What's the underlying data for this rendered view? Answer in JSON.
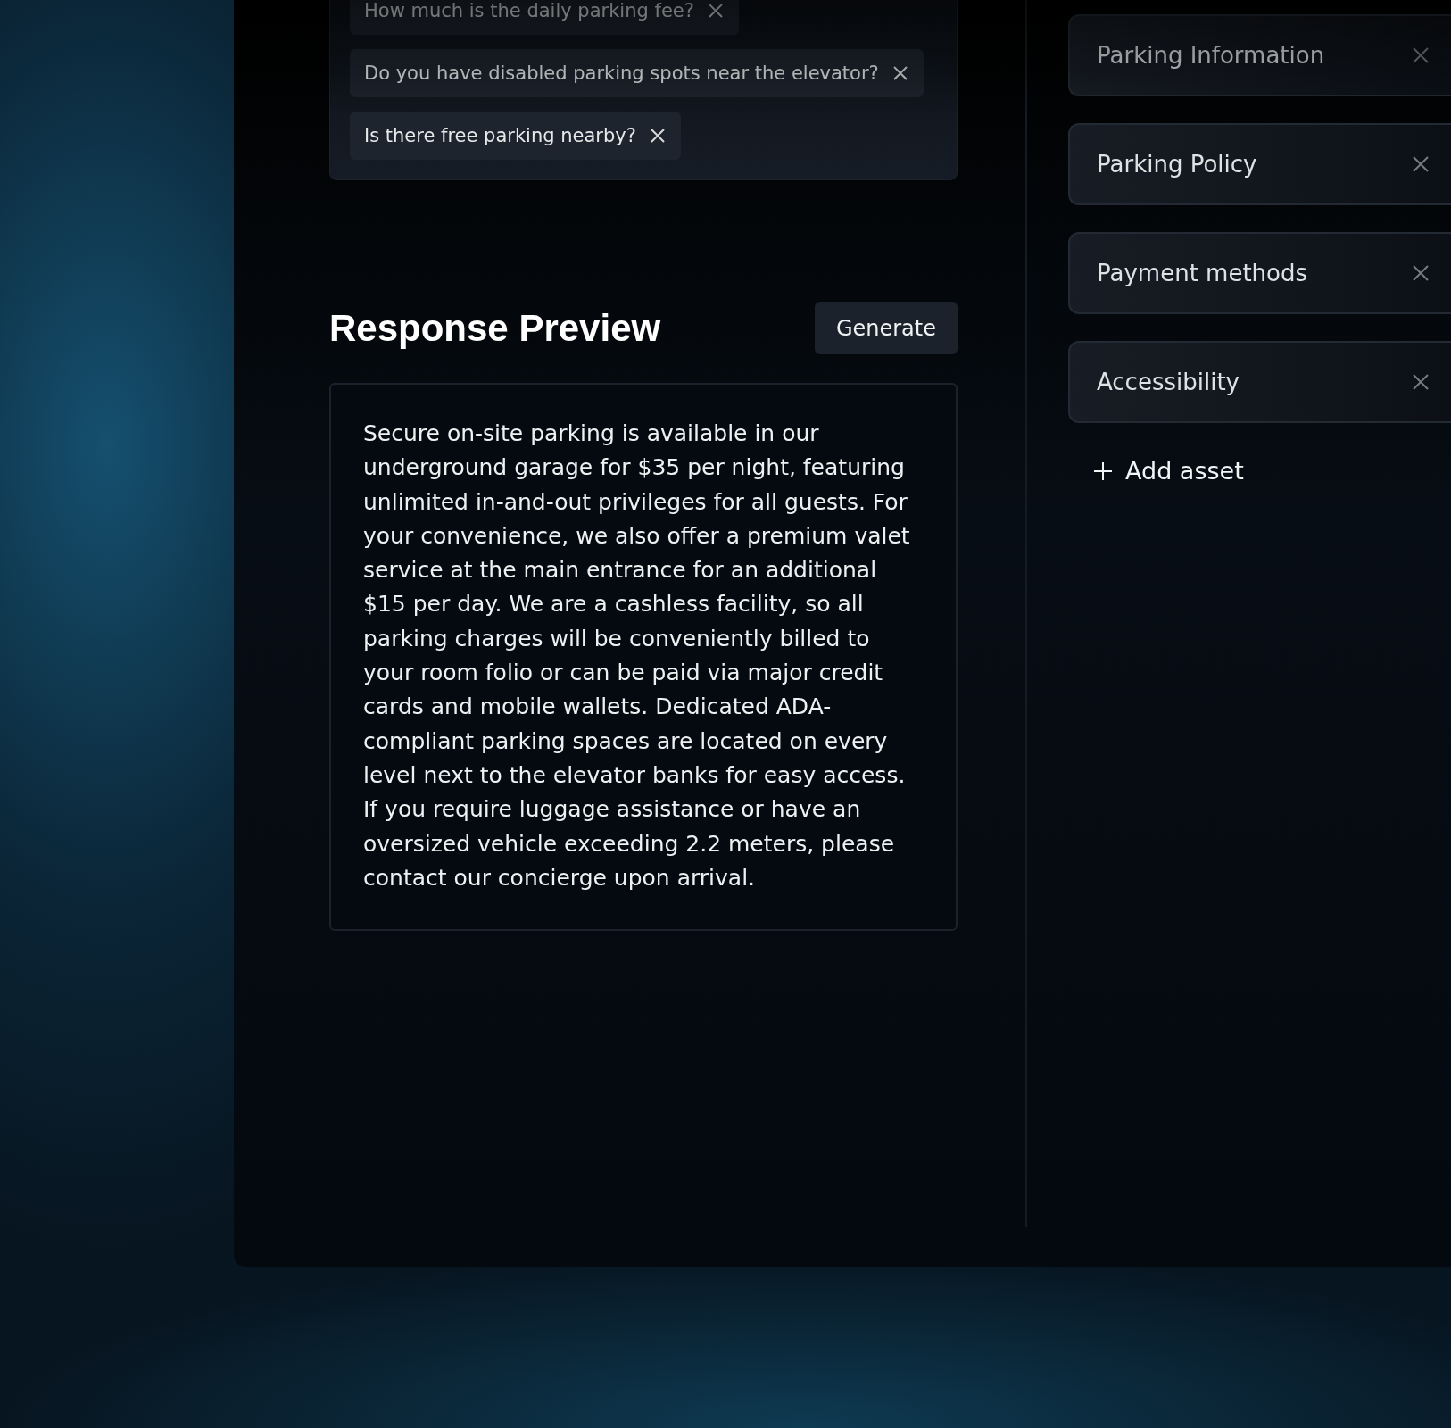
{
  "questions": [
    {
      "text": "How much is the daily parking fee?"
    },
    {
      "text": "Do you have disabled parking spots near the elevator?"
    },
    {
      "text": "Is there free parking nearby?"
    }
  ],
  "preview": {
    "title": "Response Preview",
    "button": "Generate",
    "text": "Secure on-site parking is available in our underground garage for $35 per night, featuring unlimited in-and-out privileges for all guests. For your convenience, we also offer a premium valet service at the main entrance for an additional $15 per day. We are a cashless facility, so all parking charges will be conveniently billed to your room folio or can be paid via major credit cards and mobile wallets. Dedicated ADA-compliant parking spaces are located on every level next to the elevator banks for easy access. If you require luggage assistance or have an oversized vehicle exceeding 2.2 meters, please contact our concierge upon arrival."
  },
  "assets": [
    {
      "label": "Parking Information"
    },
    {
      "label": "Parking Policy"
    },
    {
      "label": "Payment methods"
    },
    {
      "label": "Accessibility"
    }
  ],
  "add_asset": "Add asset"
}
